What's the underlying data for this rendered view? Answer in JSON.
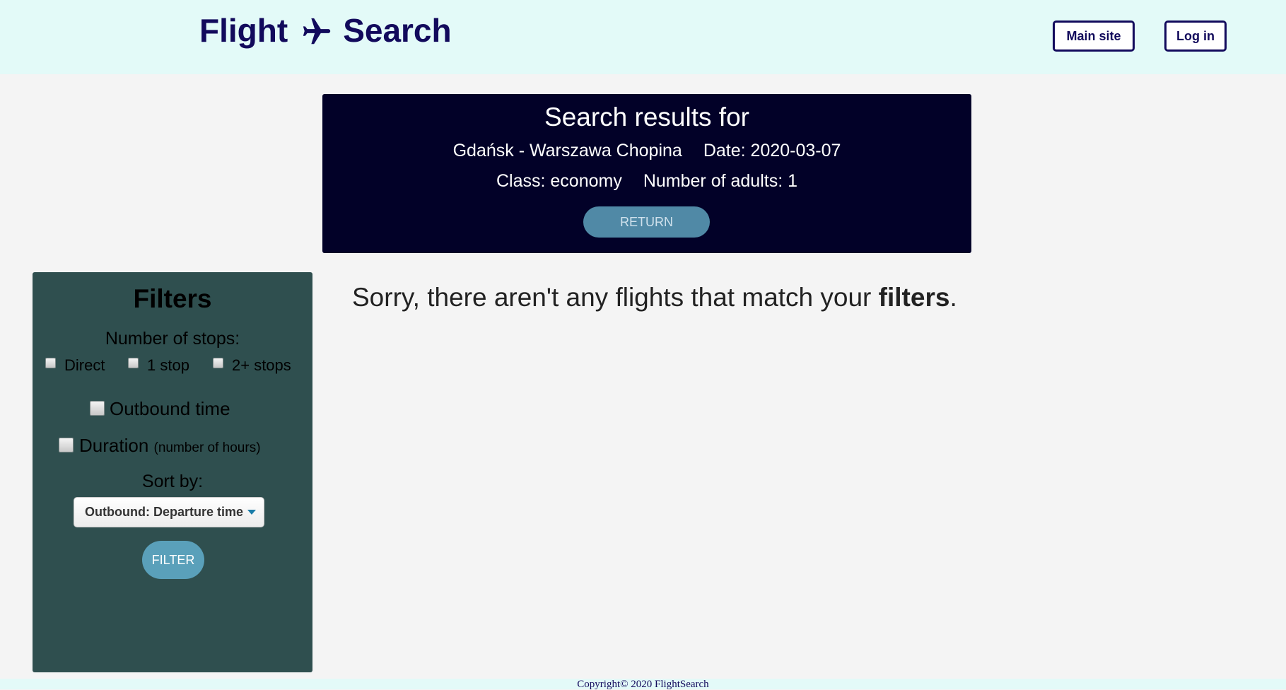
{
  "header": {
    "logo_word1": "Flight",
    "logo_icon": "airplane-icon",
    "logo_word2": "Search",
    "main_site_label": "Main site",
    "login_label": "Log in"
  },
  "results": {
    "title": "Search results for",
    "route": "Gdańsk - Warszawa Chopina",
    "date": "Date: 2020-03-07",
    "class": "Class: economy",
    "adults": "Number of adults: 1",
    "return_label": "RETURN"
  },
  "filters": {
    "title": "Filters",
    "stops_label": "Number of stops:",
    "stops_options": [
      {
        "label": "Direct",
        "checked": false
      },
      {
        "label": "1 stop",
        "checked": false
      },
      {
        "label": "2+ stops",
        "checked": false
      }
    ],
    "outbound_label": "Outbound time",
    "outbound_checked": false,
    "duration_label": "Duration",
    "duration_note": "(number of hours)",
    "duration_checked": false,
    "sort_label": "Sort by:",
    "sort_value": "Outbound: Departure time",
    "filter_label": "FILTER"
  },
  "main": {
    "message_prefix": "Sorry, there aren't any flights that match your ",
    "message_bold": "filters",
    "message_suffix": "."
  },
  "footer": {
    "copyright": "Copyright© 2020 FlightSearch"
  },
  "colors": {
    "header_bg": "#e3faf8",
    "brand": "#120a5c",
    "results_bg": "#020128",
    "filters_bg": "#2f4f4f",
    "button_blue": "#5089a6"
  }
}
